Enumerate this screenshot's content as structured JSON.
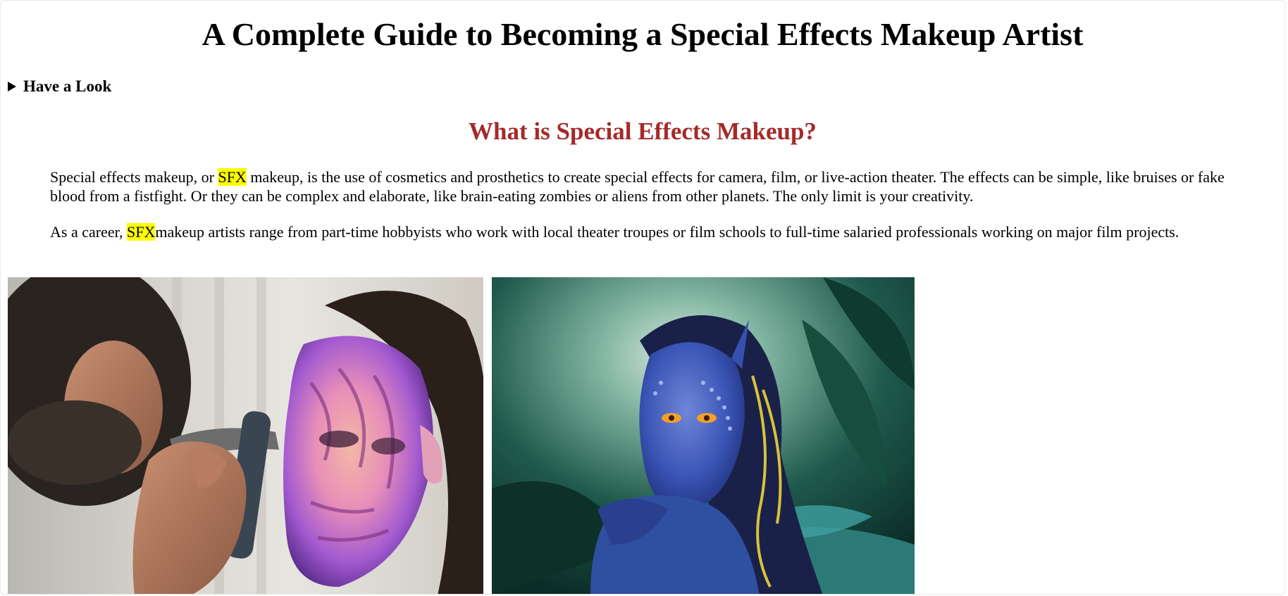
{
  "page": {
    "title": "A Complete Guide to Becoming a Special Effects Makeup Artist"
  },
  "details": {
    "summary": "Have a Look"
  },
  "section": {
    "heading": "What is Special Effects Makeup?",
    "paragraph1": {
      "before": "Special effects makeup, or ",
      "highlight": "SFX",
      "after": " makeup, is the use of cosmetics and prosthetics to create special effects for camera, film, or live-action theater. The effects can be simple, like bruises or fake blood from a fistfight. Or they can be complex and elaborate, like brain-eating zombies or aliens from other planets. The only limit is your creativity."
    },
    "paragraph2": {
      "before": "As a career, ",
      "highlight": "SFX",
      "after": "makeup artists range from part-time hobbyists who work with local theater troupes or film schools to full-time salaried professionals working on major film projects."
    }
  },
  "images": [
    {
      "name": "airbrush-artist-photo",
      "subject": "artist airbrushing creature makeup"
    },
    {
      "name": "blue-alien-photo",
      "subject": "woman in blue alien makeup in jungle"
    }
  ],
  "colors": {
    "heading_accent": "#a52a2a",
    "highlight": "#ffff00"
  }
}
